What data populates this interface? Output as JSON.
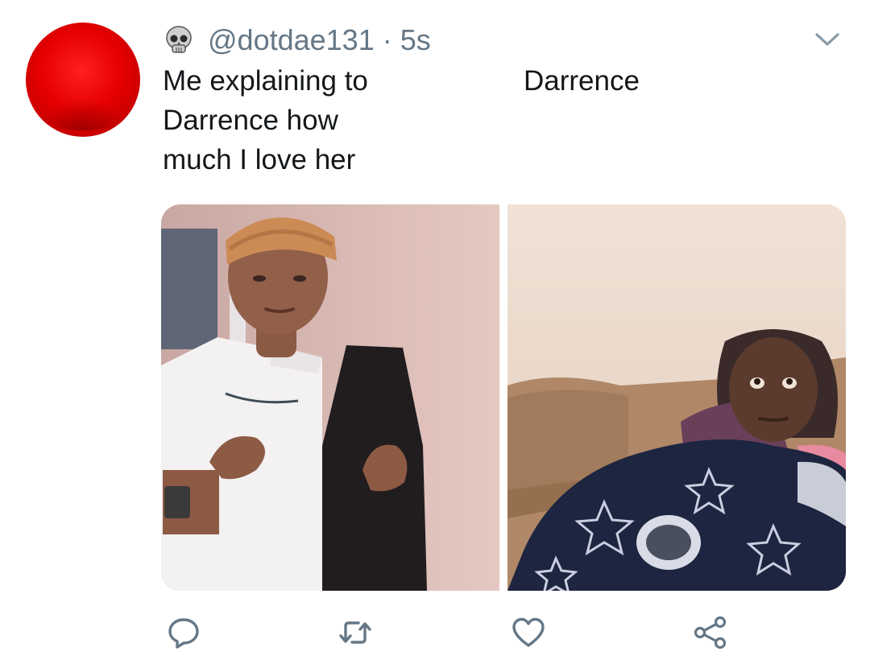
{
  "tweet": {
    "handle": "@dotdae131",
    "separator": "·",
    "time": "5s",
    "caption_left": "Me explaining to\nDarrence how\nmuch I love her",
    "caption_right": "Darrence"
  },
  "icons": {
    "user_badge": "skull-icon",
    "menu": "chevron-down-icon",
    "reply": "reply-icon",
    "retweet": "retweet-icon",
    "like": "heart-icon",
    "share": "share-icon"
  },
  "colors": {
    "avatar": "#e60000",
    "meta_text": "#657786",
    "body_text": "#14171a",
    "icon": "#657786"
  }
}
